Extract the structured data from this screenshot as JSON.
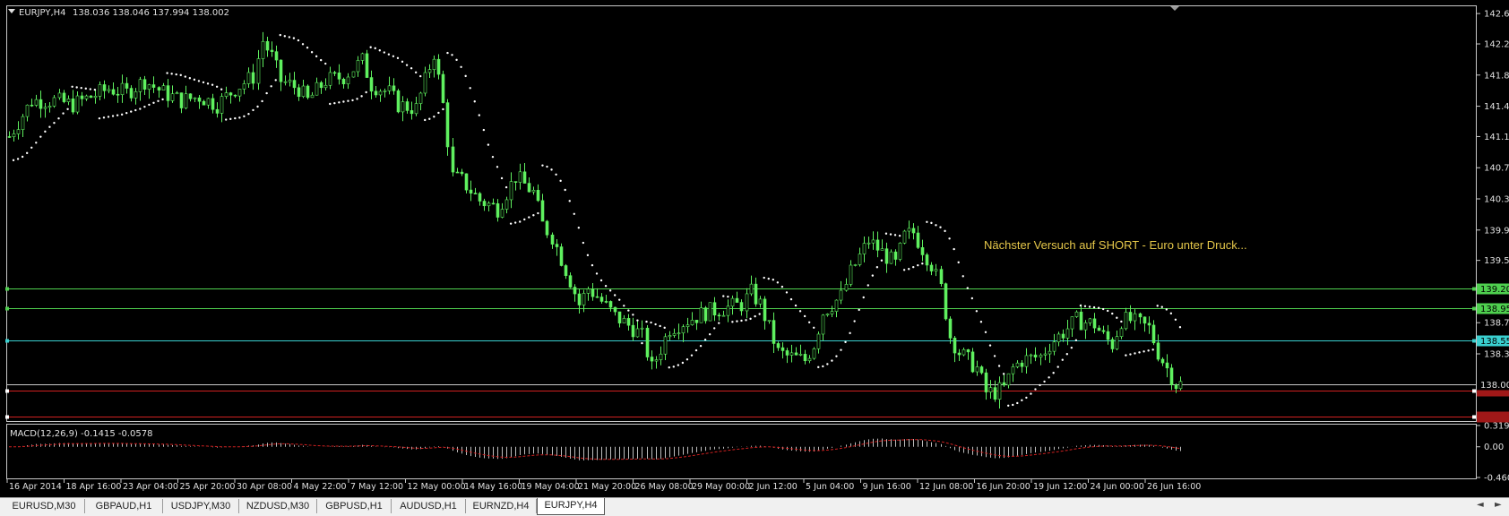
{
  "header": {
    "symbol": "EURJPY,H4",
    "ohlc": "138.036 138.046 137.994 138.002",
    "menu_icon": "dropdown-triangle-icon"
  },
  "annotation": {
    "text": "Nächster Versuch auf SHORT - Euro unter Druck...",
    "color": "#e6c84a"
  },
  "price_axis": {
    "ticks": [
      "142.640",
      "142.260",
      "141.870",
      "141.480",
      "141.100",
      "140.710",
      "140.320",
      "139.930",
      "139.550",
      "138.770",
      "138.380"
    ],
    "range": [
      137.55,
      142.72
    ]
  },
  "levels": [
    {
      "price": 139.2,
      "label": "139.200",
      "color": "#4fd04f"
    },
    {
      "price": 138.95,
      "label": "138.950",
      "color": "#4fd04f"
    },
    {
      "price": 138.55,
      "label": "138.550",
      "color": "#3ad0d0"
    },
    {
      "price": 137.92,
      "label": "",
      "color": "#d02020"
    },
    {
      "price": 137.6,
      "label": "",
      "color": "#d02020"
    }
  ],
  "current_price": {
    "label": "138.002",
    "price": 138.002
  },
  "macd": {
    "title": "MACD(12,26,9) -0.1415 -0.0578",
    "ticks": [
      "0.319",
      "0.00",
      "-0.4605"
    ],
    "range": [
      -0.4605,
      0.319
    ]
  },
  "time_axis": {
    "labels": [
      "16 Apr 2014",
      "18 Apr 16:00",
      "23 Apr 04:00",
      "25 Apr 20:00",
      "30 Apr 08:00",
      "4 May 22:00",
      "7 May 12:00",
      "12 May 00:00",
      "14 May 16:00",
      "19 May 04:00",
      "21 May 20:00",
      "26 May 08:00",
      "29 May 00:00",
      "2 Jun 12:00",
      "5 Jun 04:00",
      "9 Jun 16:00",
      "12 Jun 08:00",
      "16 Jun 20:00",
      "19 Jun 12:00",
      "24 Jun 00:00",
      "26 Jun 16:00"
    ]
  },
  "chart_data": {
    "type": "candlestick",
    "symbol": "EURJPY",
    "timeframe": "H4",
    "close_path": [
      [
        0,
        141.1
      ],
      [
        5,
        141.55
      ],
      [
        10,
        141.55
      ],
      [
        14,
        141.5
      ],
      [
        18,
        141.6
      ],
      [
        22,
        141.7
      ],
      [
        26,
        141.65
      ],
      [
        30,
        141.8
      ],
      [
        34,
        141.65
      ],
      [
        38,
        141.55
      ],
      [
        42,
        141.6
      ],
      [
        46,
        141.5
      ],
      [
        50,
        141.7
      ],
      [
        54,
        141.85
      ],
      [
        56,
        142.3
      ],
      [
        58,
        142.1
      ],
      [
        60,
        141.8
      ],
      [
        64,
        141.7
      ],
      [
        66,
        141.55
      ],
      [
        70,
        141.8
      ],
      [
        74,
        141.85
      ],
      [
        78,
        142.05
      ],
      [
        80,
        141.75
      ],
      [
        84,
        141.65
      ],
      [
        86,
        141.5
      ],
      [
        90,
        141.45
      ],
      [
        92,
        141.8
      ],
      [
        94,
        142.15
      ],
      [
        96,
        141.5
      ],
      [
        98,
        140.6
      ],
      [
        100,
        140.55
      ],
      [
        104,
        140.3
      ],
      [
        108,
        140.2
      ],
      [
        110,
        140.4
      ],
      [
        112,
        140.6
      ],
      [
        116,
        140.4
      ],
      [
        118,
        140.0
      ],
      [
        120,
        139.85
      ],
      [
        124,
        139.3
      ],
      [
        126,
        139.0
      ],
      [
        128,
        139.2
      ],
      [
        130,
        139.1
      ],
      [
        134,
        138.85
      ],
      [
        138,
        138.7
      ],
      [
        140,
        138.6
      ],
      [
        142,
        138.2
      ],
      [
        146,
        138.7
      ],
      [
        150,
        138.8
      ],
      [
        154,
        138.9
      ],
      [
        158,
        138.95
      ],
      [
        162,
        139.0
      ],
      [
        164,
        139.15
      ],
      [
        166,
        139.0
      ],
      [
        168,
        138.7
      ],
      [
        170,
        138.4
      ],
      [
        172,
        138.35
      ],
      [
        176,
        138.3
      ],
      [
        178,
        138.5
      ],
      [
        180,
        138.9
      ],
      [
        184,
        139.1
      ],
      [
        186,
        139.4
      ],
      [
        188,
        139.6
      ],
      [
        190,
        139.8
      ],
      [
        194,
        139.6
      ],
      [
        196,
        139.5
      ],
      [
        198,
        139.85
      ],
      [
        200,
        139.9
      ],
      [
        204,
        139.5
      ],
      [
        206,
        139.2
      ],
      [
        208,
        138.6
      ],
      [
        210,
        138.4
      ],
      [
        212,
        138.3
      ],
      [
        214,
        138.2
      ],
      [
        216,
        137.9
      ],
      [
        218,
        137.9
      ],
      [
        220,
        137.95
      ],
      [
        222,
        138.2
      ],
      [
        224,
        138.3
      ],
      [
        228,
        138.35
      ],
      [
        230,
        138.5
      ],
      [
        234,
        138.7
      ],
      [
        236,
        138.8
      ],
      [
        240,
        138.75
      ],
      [
        242,
        138.6
      ],
      [
        244,
        138.5
      ],
      [
        246,
        138.8
      ],
      [
        248,
        138.8
      ],
      [
        252,
        138.7
      ],
      [
        254,
        138.4
      ],
      [
        256,
        138.2
      ],
      [
        258,
        138.0
      ]
    ],
    "bar_count": 260
  },
  "tabs": [
    {
      "label": "EURUSD,M30",
      "active": false
    },
    {
      "label": "GBPAUD,H1",
      "active": false
    },
    {
      "label": "USDJPY,M30",
      "active": false
    },
    {
      "label": "NZDUSD,M30",
      "active": false
    },
    {
      "label": "GBPUSD,H1",
      "active": false
    },
    {
      "label": "AUDUSD,H1",
      "active": false
    },
    {
      "label": "EURNZD,H4",
      "active": false
    },
    {
      "label": "EURJPY,H4",
      "active": true
    }
  ],
  "nav": {
    "left": "◄",
    "right": "►"
  }
}
